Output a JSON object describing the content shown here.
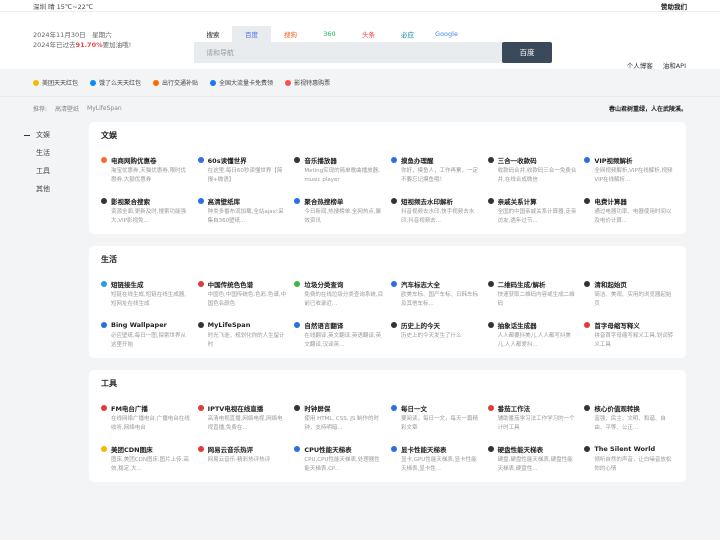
{
  "topbar": {
    "weather": "深圳 晴 15℃~22℃",
    "sponsor": "赞助我们"
  },
  "header": {
    "date_line": "2024年11月30日　星期六",
    "progress_prefix": "2024年已过去",
    "progress_pct": "91.70%",
    "progress_suffix": "要加油哦!",
    "links": [
      "个人博客",
      "油和API"
    ]
  },
  "search": {
    "engines": [
      {
        "label": "搜索",
        "color": "#222222"
      },
      {
        "label": "百度",
        "color": "#4e6ef2"
      },
      {
        "label": "搜狗",
        "color": "#fb6022"
      },
      {
        "label": "360",
        "color": "#19b955"
      },
      {
        "label": "头条",
        "color": "#f04142"
      },
      {
        "label": "必应",
        "color": "#00809d"
      },
      {
        "label": "Google",
        "color": "#4285f4"
      }
    ],
    "placeholder": "请和导航",
    "button": "百度"
  },
  "promos": [
    {
      "label": "美团天天红包",
      "color": "#f5b800"
    },
    {
      "label": "饿了么天天红包",
      "color": "#0a8bf5"
    },
    {
      "label": "出行交通补贴",
      "color": "#ff6a00"
    },
    {
      "label": "全国大流量卡免费领",
      "color": "#1677ff"
    },
    {
      "label": "影视特惠购票",
      "color": "#ff4d4f"
    }
  ],
  "tags": {
    "label": "推荐:",
    "items": [
      "高清壁纸",
      "MyLifeSpan"
    ],
    "quote": "春山君树重绿，人在武陵溪。"
  },
  "sidebar": [
    "文娱",
    "生活",
    "工具",
    "其他"
  ],
  "sections": [
    {
      "title": "文娱",
      "items": [
        {
          "title": "电商网购优惠卷",
          "desc": "淘宝优惠券,天猫优惠券,限时优惠券,大额优惠券",
          "color": "#f56c2d"
        },
        {
          "title": "60s读懂世界",
          "desc": "在这里,每日60秒读懂世界【简报+微语】",
          "color": "#2b6fe0"
        },
        {
          "title": "音乐播放器",
          "desc": "Meting实现的简单歌曲播放器, music player",
          "color": "#333333"
        },
        {
          "title": "摸鱼办理醒",
          "desc": "你好，摸鱼人，工作再累，一定不要忘记摸鱼哦！",
          "color": "#2b6fe0"
        },
        {
          "title": "三合一收款码",
          "desc": "收款码合并,收款码三合一免费合并,在线合成微信",
          "color": "#333333"
        },
        {
          "title": "VIP视频解析",
          "desc": "全网视频解析,VIP在线解析,视频VIP在线解析...",
          "color": "#2b6fe0"
        },
        {
          "title": "影视聚合搜索",
          "desc": "资源全面,更新及时,搜索功能强大,VIP影视免...",
          "color": "#333333"
        },
        {
          "title": "高清壁纸库",
          "desc": "种类多番布流加载,全站ajax!采集自360壁纸...",
          "color": "#2b6fe0"
        },
        {
          "title": "聚合热搜榜单",
          "desc": "今日新闻,热搜榜单,全网热点,聚效资讯",
          "color": "#2b6fe0"
        },
        {
          "title": "短视频去水印解析",
          "desc": "抖音视频去水印,快手视频去水印,抖音视频去...",
          "color": "#333333"
        },
        {
          "title": "亲戚关系计算",
          "desc": "全国的中国亲戚关系计算器,走亲访友,遇年过节...",
          "color": "#333333"
        },
        {
          "title": "电费计算器",
          "desc": "通过电器功率、电器使用时间以及电价计算...",
          "color": "#333333"
        }
      ]
    },
    {
      "title": "生活",
      "items": [
        {
          "title": "短链接生成",
          "desc": "短链在线生成,短链在线生成器,短网址在线生成",
          "color": "#2b9be0"
        },
        {
          "title": "中国传统色色谱",
          "desc": "中国色,中国传统色,色彩,色谱,中国色名颜色",
          "color": "#e03b3b"
        },
        {
          "title": "垃圾分类查询",
          "desc": "免费的在线垃圾分类查询系统,目前已收录近...",
          "color": "#3bb548"
        },
        {
          "title": "汽车标志大全",
          "desc": "欧美车标、国产车标、日韩车标及其他车标...",
          "color": "#2b6fe0"
        },
        {
          "title": "二维码生成/解析",
          "desc": "快速获取二维码内容或生成二维码",
          "color": "#333333"
        },
        {
          "title": "清和起始页",
          "desc": "简洁、美观、实用的浏览器起始页",
          "color": "#333333"
        },
        {
          "title": "Bing Wallpaper",
          "desc": "必应壁纸,每日一图,探索世界从这里开始",
          "color": "#2b6fe0"
        },
        {
          "title": "MyLifeSpan",
          "desc": "时光飞逝，规划化你的人生留计时",
          "color": "#333333"
        },
        {
          "title": "自然语言翻译",
          "desc": "在线翻译,英文翻译,英语翻译,英文翻译,汉译英...",
          "color": "#2b6fe0"
        },
        {
          "title": "历史上的今天",
          "desc": "历史上的今天发生了什么",
          "color": "#333333"
        },
        {
          "title": "抽象话生成器",
          "desc": "人人都要抖美儿,人人都写抖美儿,人人都爱抖...",
          "color": "#333333"
        },
        {
          "title": "首字母缩写释义",
          "desc": "拼音首字母缩写释义工具,划词转义工具",
          "color": "#e03b3b"
        }
      ]
    },
    {
      "title": "工具",
      "items": [
        {
          "title": "FM电台广播",
          "desc": "在线网络广播电台,广播电台在线收听,网络电台",
          "color": "#e03b3b"
        },
        {
          "title": "IPTV电视在线直播",
          "desc": "高清电视直播,网络电视,网络电视直播,免费在...",
          "color": "#e03b3b"
        },
        {
          "title": "时钟屏保",
          "desc": "使用 HTML, CSS, JS 制作的时钟，支持明暗...",
          "color": "#333333"
        },
        {
          "title": "每日一文",
          "desc": "要阅读，每日一文，每天一篇精彩文章",
          "color": "#2b6fe0"
        },
        {
          "title": "番茄工作法",
          "desc": "辅助番茄学习法工作学习的一个计时工具",
          "color": "#e03b3b"
        },
        {
          "title": "核心价值观转换",
          "desc": "富强、民主、文明、和谐、自由、平等、公正...",
          "color": "#333333"
        },
        {
          "title": "美团CDN图床",
          "desc": "图床,美团CDN图床,图片上传,高效,稳定,大...",
          "color": "#f5b800"
        },
        {
          "title": "网易云音乐热评",
          "desc": "网易云音乐-精彩热评热评",
          "color": "#e03b3b"
        },
        {
          "title": "CPU性能天梯表",
          "desc": "CPU,CPU性能天梯表,处理器性能天梯表,CP...",
          "color": "#2b6fe0"
        },
        {
          "title": "显卡性能天梯表",
          "desc": "显卡,GPU性能天梯表,显卡性能天梯表,显卡性...",
          "color": "#2b6fe0"
        },
        {
          "title": "硬盘性能天梯表",
          "desc": "硬盘,硬盘性能天梯表,硬盘性能天梯表,硬盘性...",
          "color": "#333333"
        },
        {
          "title": "The Silent World",
          "desc": "倾听自然的声音，让白噪音放松你的心情",
          "color": "#333333"
        }
      ]
    }
  ]
}
